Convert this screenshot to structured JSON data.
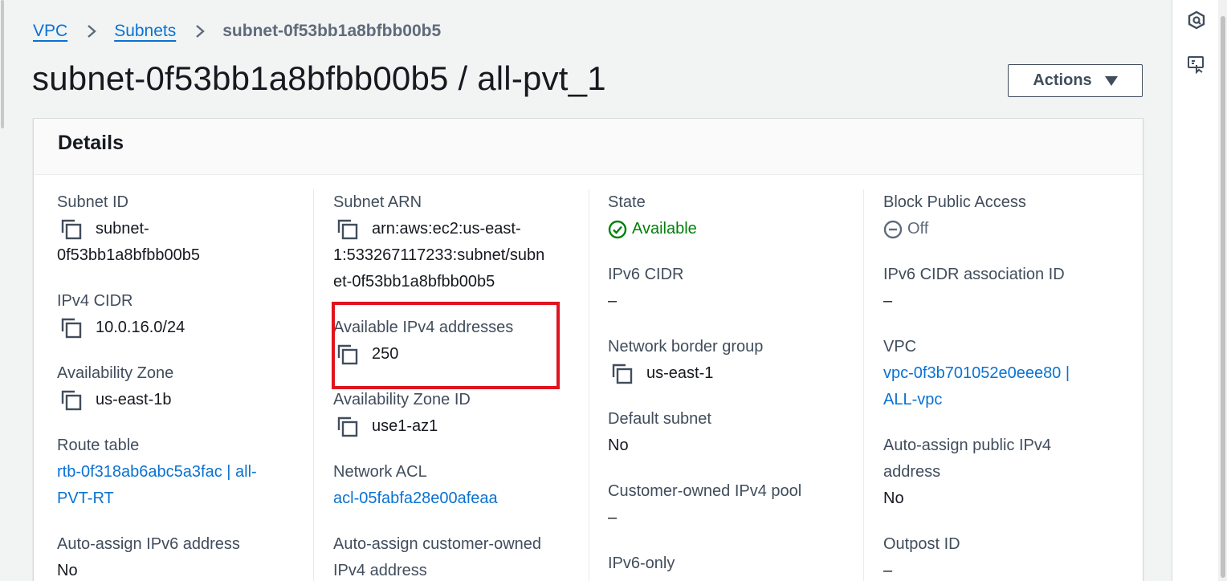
{
  "breadcrumb": {
    "items": [
      "VPC",
      "Subnets"
    ],
    "current": "subnet-0f53bb1a8bfbb00b5"
  },
  "page": {
    "title": "subnet-0f53bb1a8bfbb00b5 / all-pvt_1"
  },
  "actions": {
    "label": "Actions"
  },
  "details": {
    "heading": "Details",
    "subnet_id": {
      "label": "Subnet ID",
      "line1": "subnet-",
      "line2": "0f53bb1a8bfbb00b5"
    },
    "ipv4_cidr": {
      "label": "IPv4 CIDR",
      "value": "10.0.16.0/24"
    },
    "availability_zone": {
      "label": "Availability Zone",
      "value": "us-east-1b"
    },
    "route_table": {
      "label": "Route table",
      "line1": "rtb-0f318ab6abc5a3fac | all-",
      "line2": "PVT-RT"
    },
    "auto_assign_ipv6": {
      "label": "Auto-assign IPv6 address",
      "value": "No"
    },
    "subnet_arn": {
      "label": "Subnet ARN",
      "line1": "arn:aws:ec2:us-east-",
      "line2": "1:533267117233:subnet/subn",
      "line3": "et-0f53bb1a8bfbb00b5"
    },
    "available_ipv4": {
      "label": "Available IPv4 addresses",
      "value": "250"
    },
    "az_id": {
      "label": "Availability Zone ID",
      "value": "use1-az1"
    },
    "network_acl": {
      "label": "Network ACL",
      "value": "acl-05fabfa28e00afeaa"
    },
    "auto_assign_customer_owned": {
      "label_line1": "Auto-assign customer-owned",
      "label_line2": "IPv4 address"
    },
    "state": {
      "label": "State",
      "value": "Available"
    },
    "ipv6_cidr": {
      "label": "IPv6 CIDR",
      "value": "–"
    },
    "network_border_group": {
      "label": "Network border group",
      "value": "us-east-1"
    },
    "default_subnet": {
      "label": "Default subnet",
      "value": "No"
    },
    "customer_owned_pool": {
      "label": "Customer-owned IPv4 pool",
      "value": "–"
    },
    "ipv6_only": {
      "label": "IPv6-only"
    },
    "block_public_access": {
      "label": "Block Public Access",
      "value": "Off"
    },
    "ipv6_cidr_association": {
      "label": "IPv6 CIDR association ID",
      "value": "–"
    },
    "vpc": {
      "label": "VPC",
      "line1": "vpc-0f3b701052e0eee80 |",
      "line2": "ALL-vpc"
    },
    "auto_assign_public_ipv4": {
      "label_line1": "Auto-assign public IPv4",
      "label_line2": "address",
      "value": "No"
    },
    "outpost_id": {
      "label": "Outpost ID",
      "value": "–"
    }
  },
  "colors": {
    "link": "#0972d3",
    "success": "#037f0c",
    "highlight": "#e0141e"
  },
  "icons": [
    "chevron-right-icon",
    "copy-icon",
    "status-success-icon",
    "status-off-icon",
    "caret-down-icon",
    "cloudshell-icon",
    "feedback-icon"
  ]
}
